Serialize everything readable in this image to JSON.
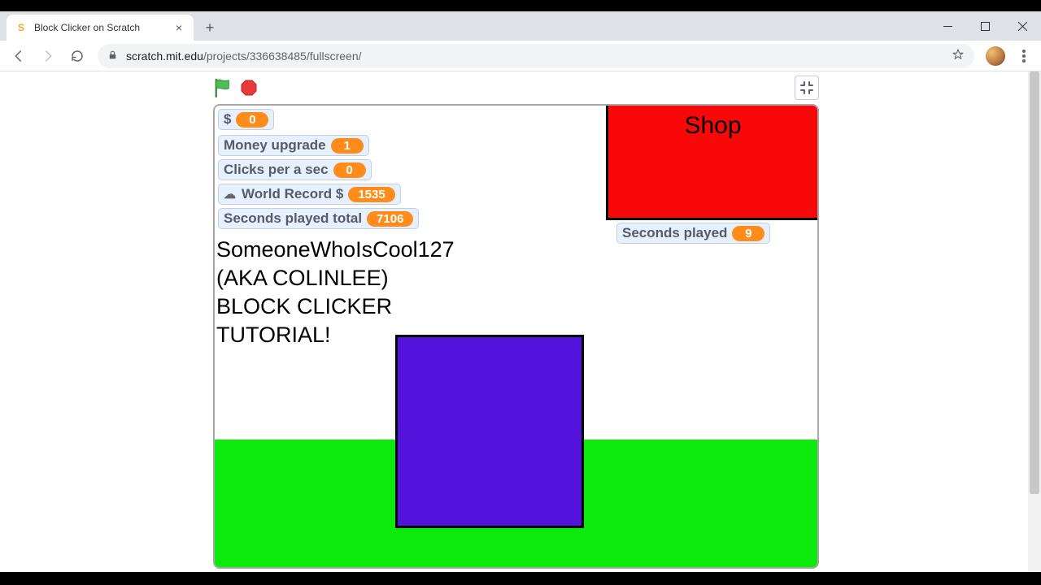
{
  "browser": {
    "tab_title": "Block Clicker on Scratch",
    "url_host": "scratch.mit.edu",
    "url_path": "/projects/336638485/fullscreen/"
  },
  "game": {
    "shop_label": "Shop",
    "tutorial_text": "SomeoneWhoIsCool127\n(AKA COLINLEE)\nBLOCK CLICKER\nTUTORIAL!",
    "monitors": {
      "money": {
        "label": "$",
        "value": "0"
      },
      "money_upgrade": {
        "label": "Money upgrade",
        "value": "1"
      },
      "clicks_per_sec": {
        "label": "Clicks per a sec",
        "value": "0"
      },
      "world_record": {
        "label": "World Record $",
        "value": "1535",
        "cloud": true
      },
      "seconds_total": {
        "label": "Seconds played total",
        "value": "7106"
      },
      "seconds_played": {
        "label": "Seconds played",
        "value": "9"
      }
    }
  }
}
